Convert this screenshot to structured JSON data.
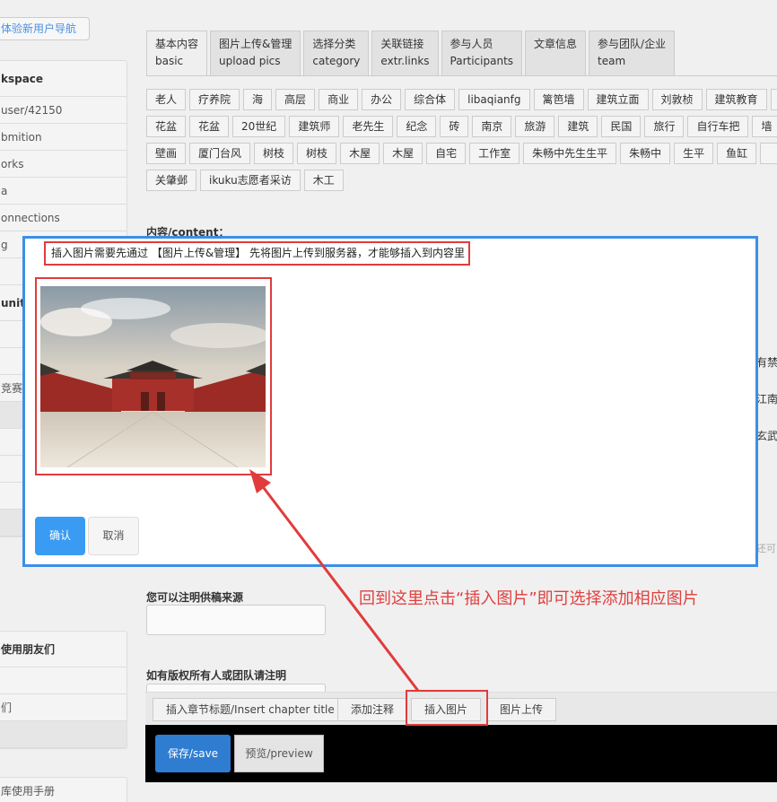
{
  "sidebar": {
    "guide_button": "体验新用户导航",
    "workspace_panel": [
      "kspace",
      "user/42150",
      "bmition",
      "orks",
      "a",
      "onnections",
      "g",
      "",
      "unity",
      "",
      "",
      "竞赛",
      "",
      "",
      "",
      "",
      ""
    ],
    "friends_panel": [
      "使用朋友们",
      "",
      "们",
      ""
    ],
    "manual_label": "库使用手册"
  },
  "tabs": [
    {
      "zh": "基本内容",
      "en": "basic"
    },
    {
      "zh": "图片上传&管理",
      "en": "upload pics"
    },
    {
      "zh": "选择分类",
      "en": "category"
    },
    {
      "zh": "关联链接",
      "en": "extr.links"
    },
    {
      "zh": "参与人员",
      "en": "Participants"
    },
    {
      "zh": "文章信息",
      "en": ""
    },
    {
      "zh": "参与团队/企业",
      "en": "team"
    }
  ],
  "tag_rows": [
    [
      "老人",
      "疗养院",
      "海",
      "高层",
      "商业",
      "办公",
      "综合体",
      "libaqianfg",
      "篱笆墙",
      "建筑立面",
      "刘敦桢",
      "建筑教育",
      " "
    ],
    [
      "花盆",
      "花盆",
      "20世纪",
      "建筑师",
      "老先生",
      "纪念",
      "砖",
      "南京",
      "旅游",
      "建筑",
      "民国",
      "旅行",
      "自行车把",
      "墙"
    ],
    [
      "壁画",
      "厦门台风",
      "树枝",
      "树枝",
      "木屋",
      "木屋",
      "自宅",
      "工作室",
      "朱畅中先生生平",
      "朱畅中",
      "生平",
      "鱼缸",
      " "
    ],
    [
      "关肇邺",
      "ikuku志愿者采访",
      "木工"
    ]
  ],
  "content_label": "内容/content：",
  "right_peek": [
    "有禁",
    "江南",
    "玄武",
    "还可"
  ],
  "source_label": "您可以注明供稿来源",
  "copyright_label": "如有版权所有人或团队请注明",
  "toolbar": {
    "insert_chapter": "插入章节标题/Insert chapter title",
    "add_note": "添加注释",
    "insert_image": "插入图片",
    "image_upload": "图片上传"
  },
  "actions": {
    "save": "保存/save",
    "preview": "预览/preview"
  },
  "modal": {
    "hint": "插入图片需要先通过 【图片上传&管理】 先将图片上传到服务器，才能够插入到内容里",
    "confirm": "确认",
    "cancel": "取消"
  },
  "annotation": "回到这里点击“插入图片”即可选择添加相应图片",
  "colors": {
    "modal_border": "#3b8fe8",
    "highlight": "#e03c3c",
    "primary_button": "#3a9bf3",
    "save_button": "#2f7dd0"
  }
}
